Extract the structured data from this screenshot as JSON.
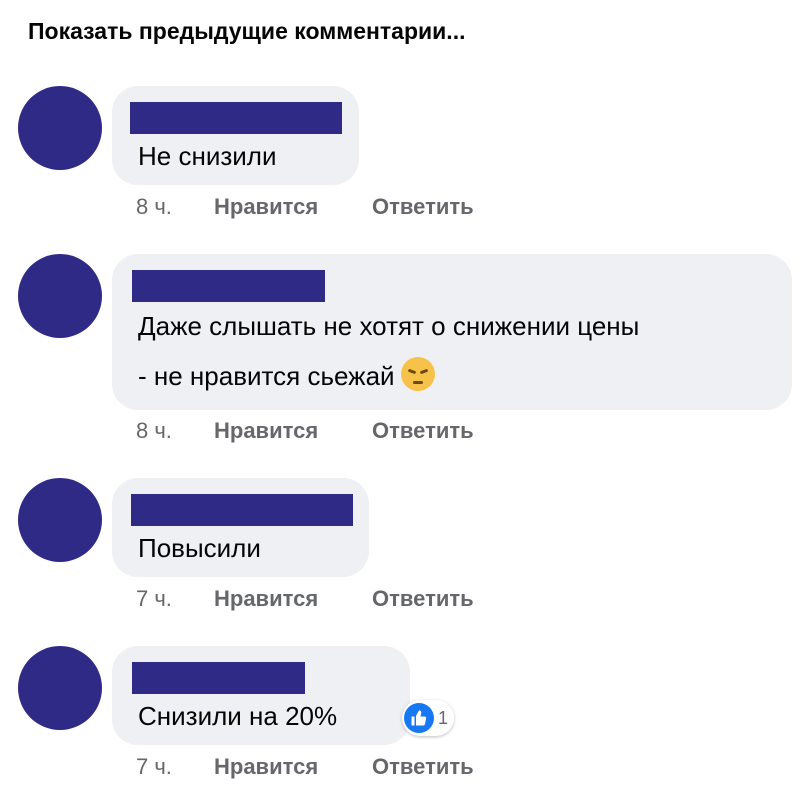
{
  "show_previous_label": "Показать предыдущие комментарии...",
  "colors": {
    "avatar": "#2f2a86",
    "bubble": "#eff0f4",
    "like_blue": "#1877f2"
  },
  "comments": [
    {
      "text": "Не снизили",
      "time": "8 ч.",
      "like_label": "Нравится",
      "reply_label": "Ответить"
    },
    {
      "text_line1": "Даже слышать не хотят о снижении цены",
      "text_line2": "- не нравится сьежай",
      "emoji": "pensive-face-icon",
      "time": "8 ч.",
      "like_label": "Нравится",
      "reply_label": "Ответить"
    },
    {
      "text": "Повысили",
      "time": "7 ч.",
      "like_label": "Нравится",
      "reply_label": "Ответить"
    },
    {
      "text": "Снизили на 20%",
      "reaction_count": "1",
      "time": "7 ч.",
      "like_label": "Нравится",
      "reply_label": "Ответить"
    }
  ]
}
